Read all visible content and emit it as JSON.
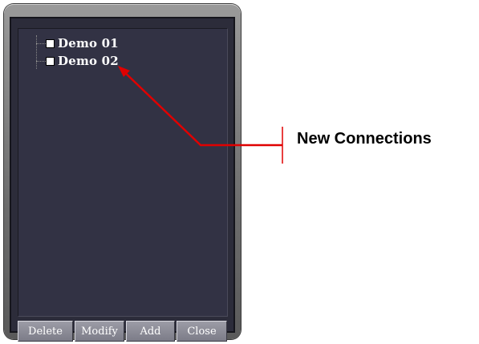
{
  "window": {
    "tree_items": [
      {
        "label": "Demo 01",
        "checked": false
      },
      {
        "label": "Demo 02",
        "checked": false
      }
    ],
    "buttons": {
      "delete": "Delete",
      "modify": "Modify",
      "add": "Add",
      "close": "Close"
    }
  },
  "annotation": {
    "label": "New Connections",
    "arrow_color": "#e00000"
  },
  "colors": {
    "panel_bg": "#323244",
    "frame": "#6d6d6d",
    "button": "#8c8c96"
  }
}
